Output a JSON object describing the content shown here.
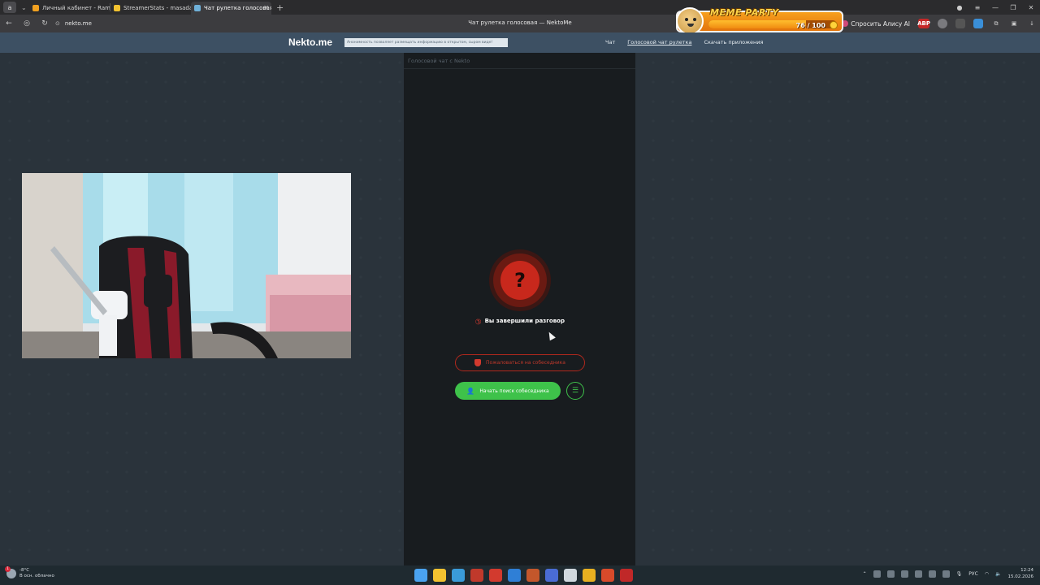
{
  "browser": {
    "workspace_label": "a",
    "tabs": [
      {
        "label": "Личный кабинет - Ramp",
        "favicon_color": "#f0a020",
        "active": false
      },
      {
        "label": "StreamerStats - masadaz",
        "favicon_color": "#f2c230",
        "active": false
      },
      {
        "label": "Чат рулетка голосовая",
        "favicon_color": "#6fb0d8",
        "active": true
      }
    ],
    "url": "nekto.me",
    "page_title": "Чат рулетка голосовая — NektoMe",
    "alice_label": "Спросить Алису AI",
    "abp_label": "ABP"
  },
  "meme_party": {
    "title": "MEME PARTY",
    "counter": "76 / 100",
    "progress": 0.76
  },
  "site": {
    "logo": "Nekto.me",
    "notice": "Анонимность позволяет размещать информацию в открытом, сыром виде!",
    "nav": [
      {
        "label": "Чат",
        "current": false
      },
      {
        "label": "Голосовой чат рулетка",
        "current": true
      },
      {
        "label": "Скачать приложения",
        "current": false
      }
    ]
  },
  "panel": {
    "title": "Голосовой чат с Nekto",
    "status_icon": "question-mark-icon",
    "status_glyph": "?",
    "ended_text": "Вы завершили разговор",
    "report_button": "Пожаловаться на собеседника",
    "search_button": "Начать поиск собеседника"
  },
  "taskbar": {
    "weather_temp": "-8°C",
    "weather_desc": "В осн. облачно",
    "weather_badge": "1",
    "app_colors": [
      "#4aa3f0",
      "#f2c230",
      "#3a9bd9",
      "#c0392b",
      "#d23a2e",
      "#2f7fd6",
      "#c4572b",
      "#4a6cd4",
      "#d0d8de",
      "#e8b020",
      "#d84a2a",
      "#c02828"
    ],
    "lang": "РУС",
    "time": "12:24",
    "date": "15.02.2026"
  }
}
